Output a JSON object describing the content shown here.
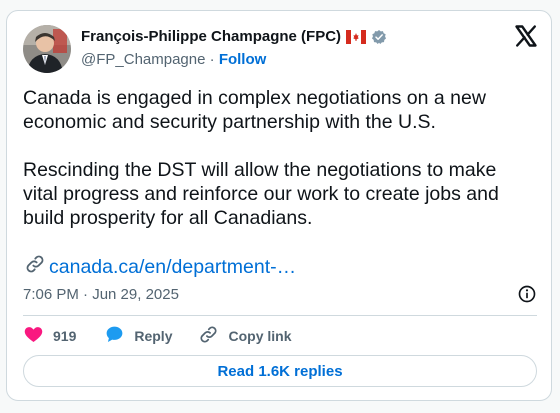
{
  "author": {
    "display_name": "François-Philippe Champagne (FPC)",
    "handle": "@FP_Champagne",
    "separator": " · ",
    "follow_label": "Follow"
  },
  "tweet": {
    "paragraph_1": "Canada is engaged in complex negotiations on a new economic and security partnership with the U.S.",
    "paragraph_2": "Rescinding the DST will allow the negotiations to make vital progress and reinforce our work to create jobs and build prosperity for all Canadians.",
    "link_text": "canada.ca/en/department-…",
    "timestamp": "7:06 PM · Jun 29, 2025"
  },
  "actions": {
    "like_count": "919",
    "reply_label": "Reply",
    "copy_link_label": "Copy link"
  },
  "footer": {
    "read_replies_label": "Read 1.6K replies"
  },
  "icons": {
    "logo": "x-logo-icon",
    "flag": "canada-flag-icon",
    "verified": "verified-badge-icon",
    "link": "link-icon",
    "info": "info-icon",
    "like": "heart-icon",
    "reply": "speech-bubble-icon",
    "copy": "link-chain-icon"
  },
  "colors": {
    "accent": "#006fd6",
    "like": "#f91880",
    "reply": "#1d9bf0",
    "muted": "#536471",
    "verified": "#829aab",
    "flag_red": "#d52b1e"
  }
}
